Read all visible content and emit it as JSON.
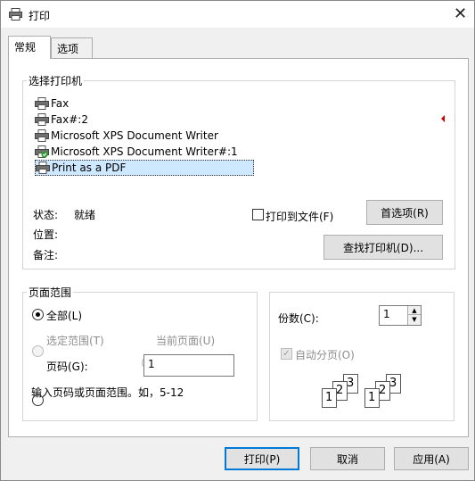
{
  "window": {
    "title": "打印"
  },
  "tabs": [
    {
      "label": "常规"
    },
    {
      "label": "选项"
    }
  ],
  "select_printer": {
    "group_label": "选择打印机",
    "printers": [
      {
        "name": "Fax"
      },
      {
        "name": "Fax#:2"
      },
      {
        "name": "Microsoft XPS Document Writer"
      },
      {
        "name": "Microsoft XPS Document Writer#:1"
      },
      {
        "name": "Print as a PDF"
      }
    ],
    "status_label": "状态:",
    "status_value": "就绪",
    "location_label": "位置:",
    "comment_label": "备注:",
    "print_to_file_label": "打印到文件(F)",
    "preferences_button": "首选项(R)",
    "find_printer_button": "查找打印机(D)..."
  },
  "page_range": {
    "group_label": "页面范围",
    "all_label": "全部(L)",
    "selection_label": "选定范围(T)",
    "current_page_label": "当前页面(U)",
    "pages_label": "页码(G):",
    "pages_value": "1",
    "hint": "输入页码或页面范围。如，5-12"
  },
  "copies": {
    "label": "份数(C):",
    "value": "1",
    "collate_label": "自动分页(O)",
    "collate_icon_digits": [
      "1",
      "2",
      "3"
    ]
  },
  "footer": {
    "print_button": "打印(P)",
    "cancel_button": "取消",
    "apply_button": "应用(A)"
  },
  "colors": {
    "selection": "#cde8ff",
    "accent": "#0078d7",
    "status_check": "#2a9d2a"
  }
}
